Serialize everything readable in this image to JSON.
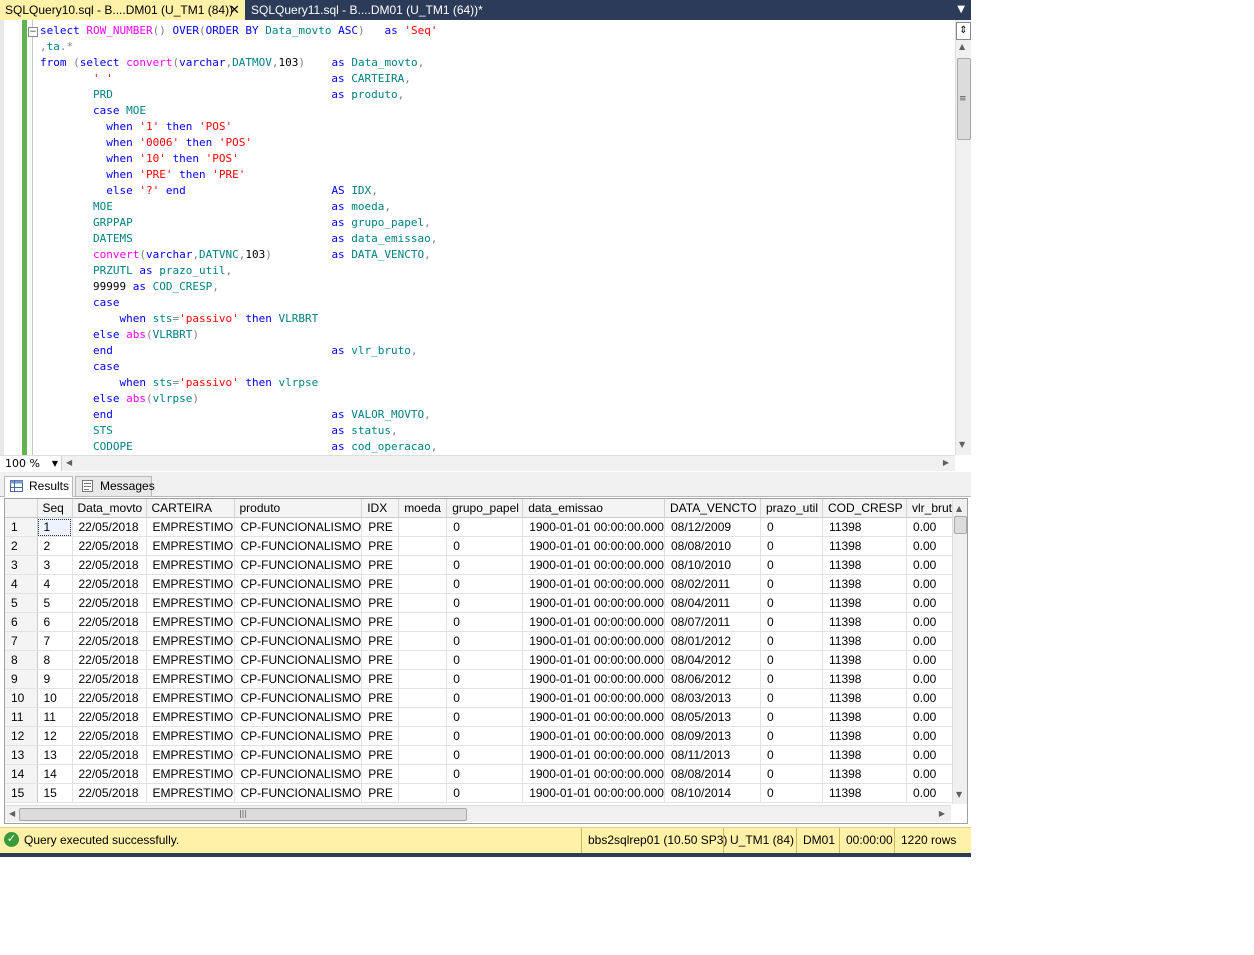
{
  "tabs": {
    "active": "SQLQuery10.sql - B....DM01 (U_TM1 (84))",
    "inactive": "SQLQuery11.sql - B....DM01 (U_TM1 (64))*",
    "close_glyph": "✕"
  },
  "editor": {
    "lines": [
      "select ROW_NUMBER() OVER(ORDER BY Data_movto ASC)   as 'Seq'",
      ",ta.*",
      "from (select convert(varchar,DATMOV,103)    as Data_movto,",
      "        ' '                                 as CARTEIRA,",
      "        PRD                                 as produto,",
      "        case MOE",
      "          when '1' then 'POS'",
      "          when '0006' then 'POS'",
      "          when '10' then 'POS'",
      "          when 'PRE' then 'PRE'",
      "          else '?' end                      AS IDX,",
      "        MOE                                 as moeda,",
      "        GRPPAP                              as grupo_papel,",
      "        DATEMS                              as data_emissao,",
      "        convert(varchar,DATVNC,103)         as DATA_VENCTO,",
      "        PRZUTL as prazo_util,",
      "        99999 as COD_CRESP,",
      "        case",
      "            when sts='passivo' then VLRBRT",
      "        else abs(VLRBRT)",
      "        end                                 as vlr_bruto,",
      "        case",
      "            when sts='passivo' then vlrpse",
      "        else abs(vlrpse)",
      "        end                                 as VALOR_MOVTO,",
      "        STS                                 as status,",
      "        CODOPE                              as cod_operacao,"
    ],
    "zoom": "100 %"
  },
  "results": {
    "tab_results": "Results",
    "tab_messages": "Messages",
    "columns": [
      "",
      "Seq",
      "Data_movto",
      "CARTEIRA",
      "produto",
      "IDX",
      "moeda",
      "grupo_papel",
      "data_emissao",
      "DATA_VENCTO",
      "prazo_util",
      "COD_CRESP",
      "vlr_bruto"
    ],
    "rows": [
      [
        "1",
        "1",
        "22/05/2018",
        "EMPRESTIMO",
        "CP-FUNCIONALISMO",
        "PRE",
        "",
        "0",
        "1900-01-01 00:00:00.000",
        "08/12/2009",
        "0",
        "11398",
        "0.00"
      ],
      [
        "2",
        "2",
        "22/05/2018",
        "EMPRESTIMO",
        "CP-FUNCIONALISMO",
        "PRE",
        "",
        "0",
        "1900-01-01 00:00:00.000",
        "08/08/2010",
        "0",
        "11398",
        "0.00"
      ],
      [
        "3",
        "3",
        "22/05/2018",
        "EMPRESTIMO",
        "CP-FUNCIONALISMO",
        "PRE",
        "",
        "0",
        "1900-01-01 00:00:00.000",
        "08/10/2010",
        "0",
        "11398",
        "0.00"
      ],
      [
        "4",
        "4",
        "22/05/2018",
        "EMPRESTIMO",
        "CP-FUNCIONALISMO",
        "PRE",
        "",
        "0",
        "1900-01-01 00:00:00.000",
        "08/02/2011",
        "0",
        "11398",
        "0.00"
      ],
      [
        "5",
        "5",
        "22/05/2018",
        "EMPRESTIMO",
        "CP-FUNCIONALISMO",
        "PRE",
        "",
        "0",
        "1900-01-01 00:00:00.000",
        "08/04/2011",
        "0",
        "11398",
        "0.00"
      ],
      [
        "6",
        "6",
        "22/05/2018",
        "EMPRESTIMO",
        "CP-FUNCIONALISMO",
        "PRE",
        "",
        "0",
        "1900-01-01 00:00:00.000",
        "08/07/2011",
        "0",
        "11398",
        "0.00"
      ],
      [
        "7",
        "7",
        "22/05/2018",
        "EMPRESTIMO",
        "CP-FUNCIONALISMO",
        "PRE",
        "",
        "0",
        "1900-01-01 00:00:00.000",
        "08/01/2012",
        "0",
        "11398",
        "0.00"
      ],
      [
        "8",
        "8",
        "22/05/2018",
        "EMPRESTIMO",
        "CP-FUNCIONALISMO",
        "PRE",
        "",
        "0",
        "1900-01-01 00:00:00.000",
        "08/04/2012",
        "0",
        "11398",
        "0.00"
      ],
      [
        "9",
        "9",
        "22/05/2018",
        "EMPRESTIMO",
        "CP-FUNCIONALISMO",
        "PRE",
        "",
        "0",
        "1900-01-01 00:00:00.000",
        "08/06/2012",
        "0",
        "11398",
        "0.00"
      ],
      [
        "10",
        "10",
        "22/05/2018",
        "EMPRESTIMO",
        "CP-FUNCIONALISMO",
        "PRE",
        "",
        "0",
        "1900-01-01 00:00:00.000",
        "08/03/2013",
        "0",
        "11398",
        "0.00"
      ],
      [
        "11",
        "11",
        "22/05/2018",
        "EMPRESTIMO",
        "CP-FUNCIONALISMO",
        "PRE",
        "",
        "0",
        "1900-01-01 00:00:00.000",
        "08/05/2013",
        "0",
        "11398",
        "0.00"
      ],
      [
        "12",
        "12",
        "22/05/2018",
        "EMPRESTIMO",
        "CP-FUNCIONALISMO",
        "PRE",
        "",
        "0",
        "1900-01-01 00:00:00.000",
        "08/09/2013",
        "0",
        "11398",
        "0.00"
      ],
      [
        "13",
        "13",
        "22/05/2018",
        "EMPRESTIMO",
        "CP-FUNCIONALISMO",
        "PRE",
        "",
        "0",
        "1900-01-01 00:00:00.000",
        "08/11/2013",
        "0",
        "11398",
        "0.00"
      ],
      [
        "14",
        "14",
        "22/05/2018",
        "EMPRESTIMO",
        "CP-FUNCIONALISMO",
        "PRE",
        "",
        "0",
        "1900-01-01 00:00:00.000",
        "08/08/2014",
        "0",
        "11398",
        "0.00"
      ],
      [
        "15",
        "15",
        "22/05/2018",
        "EMPRESTIMO",
        "CP-FUNCIONALISMO",
        "PRE",
        "",
        "0",
        "1900-01-01 00:00:00.000",
        "08/10/2014",
        "0",
        "11398",
        "0.00"
      ]
    ]
  },
  "status": {
    "message": "Query executed successfully.",
    "server": "bbs2sqlrep01 (10.50 SP3)",
    "user": "U_TM1 (84)",
    "database": "DM01",
    "elapsed": "00:00:00",
    "rows": "1220 rows"
  },
  "colors": {
    "tab_active": "#fff1a8",
    "tab_strip": "#2b3b58",
    "status_bar": "#fff1a8",
    "change_bar": "#5fb44f",
    "keyword": "#0000ff",
    "string": "#ff0000",
    "function": "#ff00ff",
    "column": "#008080"
  },
  "icons": [
    "close-icon",
    "tab-dropdown-icon",
    "grid-icon",
    "messages-icon",
    "success-icon",
    "collapse-icon",
    "split-icon"
  ]
}
